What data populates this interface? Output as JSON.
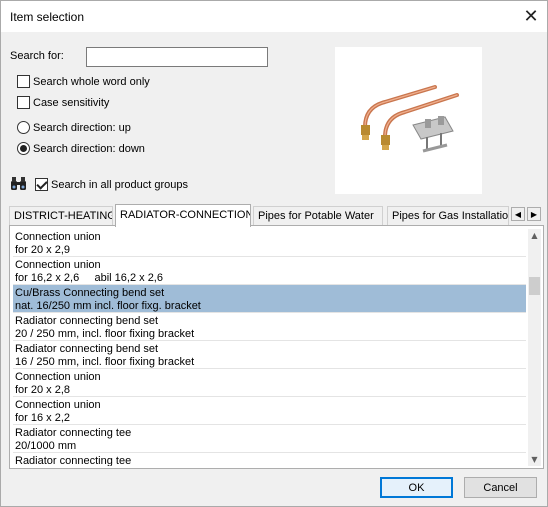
{
  "window": {
    "title": "Item selection"
  },
  "search": {
    "label": "Search for:",
    "value": "",
    "whole_word_label": "Search whole word only",
    "whole_word_checked": false,
    "case_label": "Case sensitivity",
    "case_checked": false,
    "direction_up_label": "Search direction: up",
    "direction_down_label": "Search direction: down",
    "direction_selected": "down",
    "all_groups_label": "Search in all product groups",
    "all_groups_checked": true
  },
  "tabs": [
    {
      "label": "DISTRICT-HEATING",
      "active": false
    },
    {
      "label": "RADIATOR-CONNECTION",
      "active": true
    },
    {
      "label": "Pipes for Potable Water",
      "active": false
    },
    {
      "label": "Pipes for Gas Installatio",
      "active": false
    }
  ],
  "items": [
    {
      "name": "Connection union",
      "detail": "for 20 x 2,9"
    },
    {
      "name": "Connection union",
      "detail": "for 16,2 x 2,6     abil 16,2 x 2,6"
    },
    {
      "name": "Cu/Brass Connecting bend set",
      "detail": "nat. 16/250 mm incl. floor fixg. bracket",
      "selected": true
    },
    {
      "name": "Radiator connecting bend set",
      "detail": "20 / 250 mm, incl. floor fixing bracket"
    },
    {
      "name": "Radiator connecting bend set",
      "detail": "16 / 250 mm, incl. floor fixing bracket"
    },
    {
      "name": "Connection union",
      "detail": "for 20 x 2,8"
    },
    {
      "name": "Connection union",
      "detail": "for 16 x 2,2"
    },
    {
      "name": "Radiator connecting tee",
      "detail": "20/1000 mm"
    },
    {
      "name": "Radiator connecting tee",
      "detail": ""
    }
  ],
  "list_scroll_position": 0.18,
  "buttons": {
    "ok": "OK",
    "cancel": "Cancel"
  },
  "colors": {
    "selection": "#9fbcd7",
    "default_button_border": "#0078d7"
  }
}
